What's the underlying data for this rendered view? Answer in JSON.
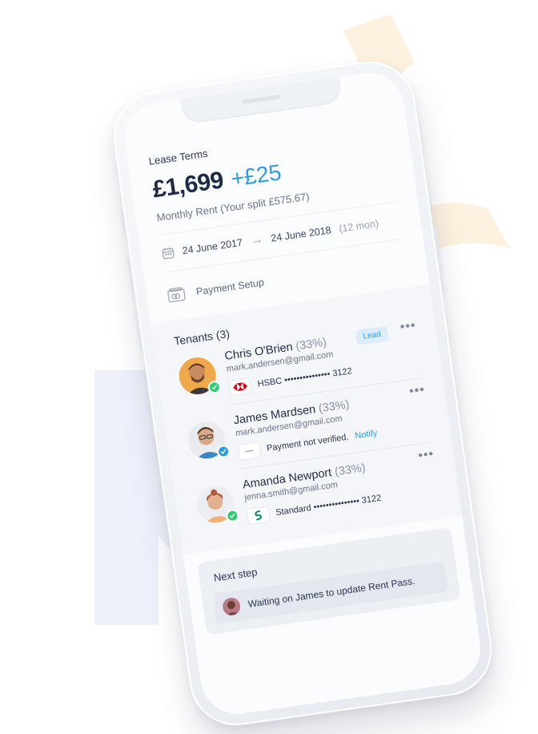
{
  "lease": {
    "label": "Lease Terms",
    "amount": "£1,699",
    "extra": "+£25",
    "subtitle": "Monthly Rent (Your split £575.67)",
    "start_date": "24 June 2017",
    "end_date": "24 June 2018",
    "duration": "(12 mon)"
  },
  "payment_setup": {
    "label": "Payment Setup"
  },
  "tenants": {
    "header": "Tenants (3)",
    "items": [
      {
        "name": "Chris O'Brien",
        "pct": "(33%)",
        "email": "mark.andersen@gmail.com",
        "bank": "HSBC ••••••••••••••• 3122",
        "badge": "Lead",
        "more": "•••"
      },
      {
        "name": "James Mardsen",
        "pct": "(33%)",
        "email": "mark.andersen@gmail.com",
        "status": "Payment not verified.",
        "notify": "Notify",
        "more": "•••"
      },
      {
        "name": "Amanda Newport",
        "pct": "(33%)",
        "email": "jenna.smith@gmail.com",
        "bank": "Standard ••••••••••••••• 3122",
        "more": "•••"
      }
    ]
  },
  "next_step": {
    "title": "Next step",
    "message": "Waiting on James to update Rent Pass."
  },
  "colors": {
    "accent": "#2d9cdb",
    "verified_green": "#2ecc71",
    "text_dark": "#1f2a44",
    "deco_blue": "#eef1fa",
    "deco_orange": "#fdf1df"
  },
  "icons": {
    "calendar": "calendar-icon",
    "arrow": "arrow-right-icon",
    "payment": "credit-card-icon",
    "more": "more-dots-icon",
    "check": "check-icon",
    "hsbc": "hsbc-logo-icon",
    "standard": "standard-chartered-logo-icon"
  }
}
